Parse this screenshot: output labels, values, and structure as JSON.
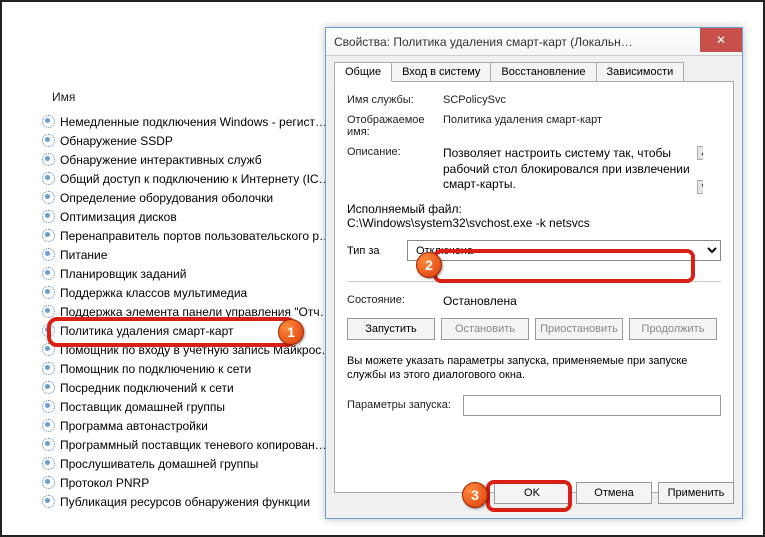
{
  "list": {
    "header": "Имя",
    "items": [
      "Немедленные подключения Windows - регист…",
      "Обнаружение SSDP",
      "Обнаружение интерактивных служб",
      "Общий доступ к подключению к Интернету (IC…",
      "Определение оборудования оболочки",
      "Оптимизация дисков",
      "Перенаправитель портов пользовательского р…",
      "Питание",
      "Планировщик заданий",
      "Поддержка классов мультимедиа",
      "Поддержка элемента панели управления \"Отч…",
      "Политика удаления смарт-карт",
      "Помощник по входу в учетную запись Майкрос…",
      "Помощник по подключению к сети",
      "Посредник подключений к сети",
      "Поставщик домашней группы",
      "Программа автонастройки",
      "Программный поставщик теневого копирован…",
      "Прослушиватель домашней группы",
      "Протокол PNRP",
      "Публикация ресурсов обнаружения функции"
    ]
  },
  "dialog": {
    "title": "Свойства: Политика удаления смарт-карт (Локальн…",
    "tabs": {
      "general": "Общие",
      "logon": "Вход в систему",
      "recovery": "Восстановление",
      "deps": "Зависимости"
    },
    "labels": {
      "serviceName": "Имя службы:",
      "displayName": "Отображаемое имя:",
      "description": "Описание:",
      "exePath": "Исполняемый файл:",
      "startupType": "Тип за",
      "state": "Состояние:",
      "startParams": "Параметры запуска:"
    },
    "values": {
      "serviceName": "SCPolicySvc",
      "displayName": "Политика удаления смарт-карт",
      "description": "Позволяет настроить систему так, чтобы рабочий стол блокировался при извлечении смарт-карты.",
      "exePath": "C:\\Windows\\system32\\svchost.exe -k netsvcs",
      "startupType": "Отключена",
      "state": "Остановлена"
    },
    "buttons": {
      "start": "Запустить",
      "stop": "Остановить",
      "pause": "Приостановить",
      "resume": "Продолжить",
      "ok": "OK",
      "cancel": "Отмена",
      "apply": "Применить"
    },
    "hint": "Вы можете указать параметры запуска, применяемые при запуске службы из этого диалогового окна."
  },
  "annotations": {
    "n1": "1",
    "n2": "2",
    "n3": "3"
  }
}
